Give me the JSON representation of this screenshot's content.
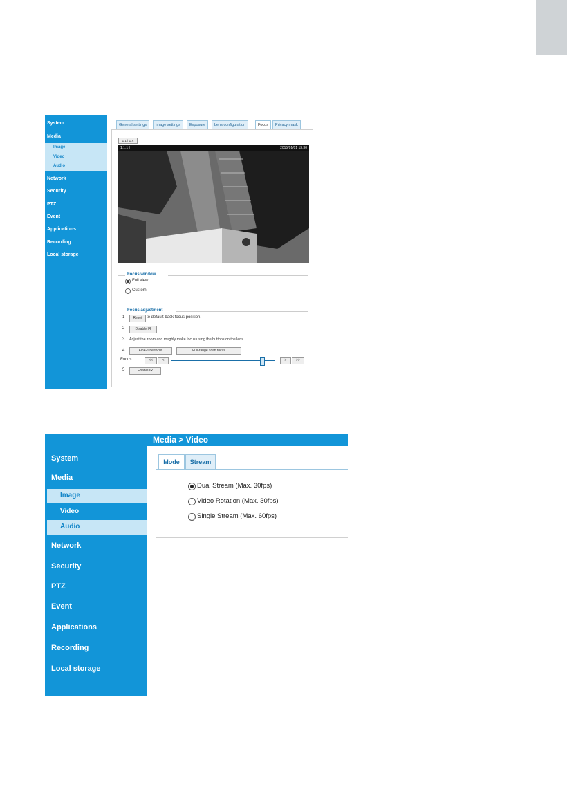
{
  "nav": {
    "system": "System",
    "media": "Media",
    "image": "Image",
    "video": "Video",
    "audio": "Audio",
    "network": "Network",
    "security": "Security",
    "ptz": "PTZ",
    "event": "Event",
    "applications": "Applications",
    "recording": "Recording",
    "local_storage": "Local storage"
  },
  "screen1": {
    "tabs": [
      "General settings",
      "Image settings",
      "Exposure",
      "Lens configuration",
      "Focus",
      "Privacy mask"
    ],
    "active_tab": "Focus",
    "view_controls": "1:1 | 1:X",
    "cam_left": "1:1:1 H",
    "cam_timestamp": "2015/01/01 13:30",
    "focus_window": {
      "legend": "Focus window",
      "full_view": "Full view",
      "custom": "Custom",
      "selected": "Full view"
    },
    "focus_adjustment": {
      "legend": "Focus adjustment",
      "step1_num": "1",
      "step1_button": "Reset",
      "step1_text": "to default back focus position.",
      "step2_num": "2",
      "step2_button": "Disable IR",
      "step3_num": "3",
      "step3_text": "Adjust the zoom and roughly make focus using the buttons on the lens.",
      "step4_num": "4",
      "fine_tune_button": "Fine-tune focus",
      "full_range_button": "Full-range scan focus",
      "focus_label": "Focus",
      "step_back_fast": "<<",
      "step_back": "<",
      "step_fwd": ">",
      "step_fwd_fast": ">>",
      "focus_level": 0.88,
      "step5_num": "5",
      "step5_button": "Enable IR"
    }
  },
  "screen2": {
    "breadcrumb": "Media  > Video",
    "tabs": [
      "Mode",
      "Stream"
    ],
    "active_tab": "Mode",
    "options": [
      "Dual Stream (Max. 30fps)",
      "Video Rotation (Max. 30fps)",
      "Single Stream (Max. 60fps)"
    ],
    "selected_index": 0
  },
  "colors": {
    "brand_blue": "#1295d8",
    "sub_highlight": "#c7e6f6",
    "sub_text": "#1285c8"
  }
}
